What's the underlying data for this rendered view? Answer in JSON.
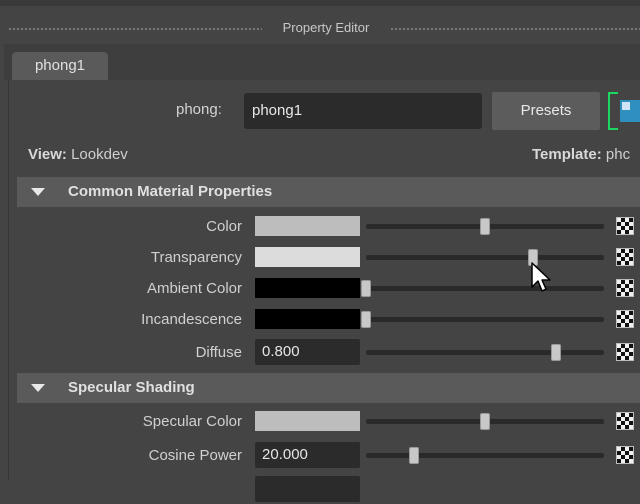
{
  "window": {
    "title": "Property Editor"
  },
  "tabs": [
    {
      "label": "phong1"
    }
  ],
  "node": {
    "type_label": "phong:",
    "name_value": "phong1",
    "presets_label": "Presets"
  },
  "view": {
    "label": "View:",
    "value": "Lookdev",
    "template_label": "Template:",
    "template_value": "phc"
  },
  "sections": [
    {
      "label": "Common Material Properties",
      "attributes": [
        {
          "label": "Color",
          "kind": "color",
          "swatch": "#bdbdbd",
          "slider": 0.5
        },
        {
          "label": "Transparency",
          "kind": "color",
          "swatch": "#dcdcdc",
          "slider": 0.7
        },
        {
          "label": "Ambient Color",
          "kind": "color",
          "swatch": "#000000",
          "slider": 0.0
        },
        {
          "label": "Incandescence",
          "kind": "color",
          "swatch": "#000000",
          "slider": 0.0
        },
        {
          "label": "Diffuse",
          "kind": "number",
          "value": "0.800",
          "slider": 0.8
        }
      ]
    },
    {
      "label": "Specular Shading",
      "attributes": [
        {
          "label": "Specular Color",
          "kind": "color",
          "swatch": "#bdbdbd",
          "slider": 0.5
        },
        {
          "label": "Cosine Power",
          "kind": "number",
          "value": "20.000",
          "slider": 0.2
        }
      ]
    }
  ],
  "icons": {
    "map": "checker-map-icon",
    "node": "node-icon",
    "cursor": "mouse-cursor-icon",
    "collapse": "collapse-triangle-icon"
  },
  "colors": {
    "accent_green": "#1ed760",
    "panel_bg": "#444444",
    "field_bg": "#2b2b2b"
  }
}
